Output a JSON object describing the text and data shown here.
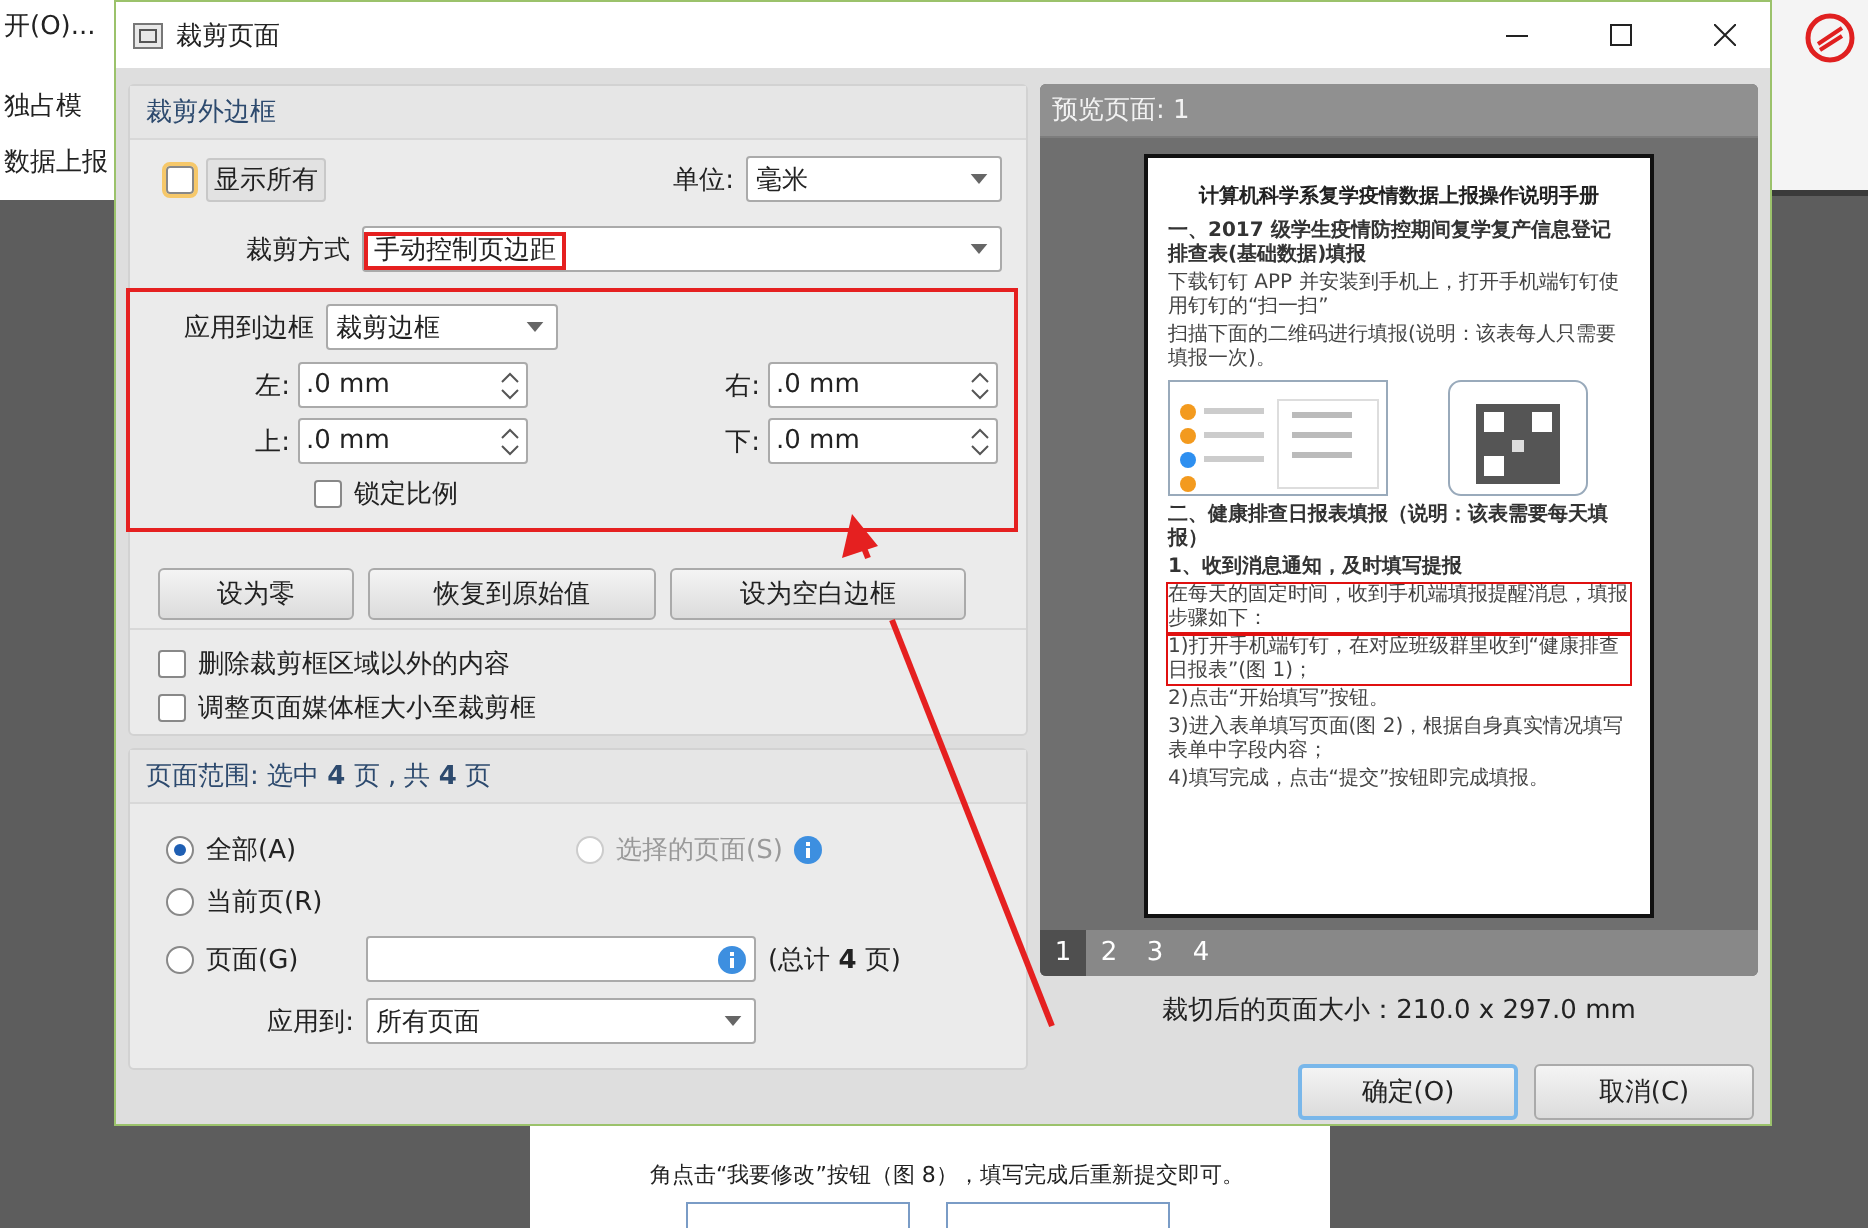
{
  "background_app": {
    "menu_item": "开(O)...",
    "mode_label": "独占模",
    "doc_tab": "数据上报",
    "doc_line": "角点击“我要修改”按钮（图 8），填写完成后重新提交即可。"
  },
  "window": {
    "title": "裁剪页面"
  },
  "crop_group": {
    "title": "裁剪外边框",
    "show_all": {
      "label": "显示所有",
      "checked": false
    },
    "unit": {
      "label": "单位:",
      "value": "毫米"
    },
    "crop_mode": {
      "label": "裁剪方式",
      "value": "手动控制页边距"
    },
    "apply_border": {
      "label": "应用到边框",
      "value": "裁剪边框"
    },
    "margins": [
      {
        "label": "左:",
        "value": ".0 mm"
      },
      {
        "label": "右:",
        "value": ".0 mm"
      },
      {
        "label": "上:",
        "value": ".0 mm"
      },
      {
        "label": "下:",
        "value": ".0 mm"
      }
    ],
    "lock_ratio": {
      "label": "锁定比例",
      "checked": false
    },
    "buttons": [
      "设为零",
      "恢复到原始值",
      "设为空白边框"
    ],
    "options": [
      {
        "label": "删除裁剪框区域以外的内容",
        "checked": false
      },
      {
        "label": "调整页面媒体框大小至裁剪框",
        "checked": false
      }
    ]
  },
  "page_range": {
    "title": "页面范围: 选中 **4** 页 , 共 **4** 页",
    "radios": [
      {
        "label": "全部(A)",
        "selected": true,
        "disabled": false
      },
      {
        "label": "选择的页面(S)",
        "selected": false,
        "disabled": true
      },
      {
        "label": "当前页(R)",
        "selected": false,
        "disabled": false
      },
      {
        "label": "页面(G)",
        "selected": false,
        "disabled": false
      }
    ],
    "pages_total": "(总计 **4** 页)",
    "apply_to": {
      "label": "应用到:",
      "value": "所有页面"
    }
  },
  "preview": {
    "title": "预览页面: 1",
    "document": [
      {
        "kind": "title",
        "text": "计算机科学系复学疫情数据上报操作说明手册",
        "highlighted": false
      },
      {
        "kind": "heading",
        "text": "一、2017 级学生疫情防控期间复学复产信息登记排查表(基础数据)填报",
        "highlighted": false
      },
      {
        "kind": "text",
        "text": "下载钉钉 APP 并安装到手机上，打开手机端钉钉使用钉钉的“扫一扫”",
        "highlighted": false
      },
      {
        "kind": "text",
        "text": "扫描下面的二维码进行填报(说明：该表每人只需要填报一次)。",
        "highlighted": false
      },
      {
        "kind": "figure"
      },
      {
        "kind": "heading",
        "text": "二、健康排查日报表填报（说明：该表需要每天填报）",
        "highlighted": false
      },
      {
        "kind": "heading",
        "text": "1、收到消息通知，及时填写提报",
        "highlighted": false
      },
      {
        "kind": "text",
        "text": "在每天的固定时间，收到手机端填报提醒消息，填报步骤如下：",
        "highlighted": true
      },
      {
        "kind": "text",
        "text": "1)打开手机端钉钉，在对应班级群里收到“健康排查日报表”(图 1)；",
        "highlighted": true
      },
      {
        "kind": "text",
        "text": "2)点击“开始填写”按钮。",
        "highlighted": false
      },
      {
        "kind": "text",
        "text": "3)进入表单填写页面(图 2)，根据自身真实情况填写表单中字段内容；",
        "highlighted": false
      },
      {
        "kind": "text",
        "text": "4)填写完成，点击“提交”按钮即完成填报。",
        "highlighted": false
      }
    ],
    "pages": [
      {
        "label": "1",
        "selected": true
      },
      {
        "label": "2",
        "selected": false
      },
      {
        "label": "3",
        "selected": false
      },
      {
        "label": "4",
        "selected": false
      }
    ],
    "size_text": "裁切后的页面大小：210.0 x 297.0 mm"
  },
  "buttons": [
    {
      "label": "确定(O)",
      "default": true
    },
    {
      "label": "取消(C)",
      "default": false
    }
  ]
}
